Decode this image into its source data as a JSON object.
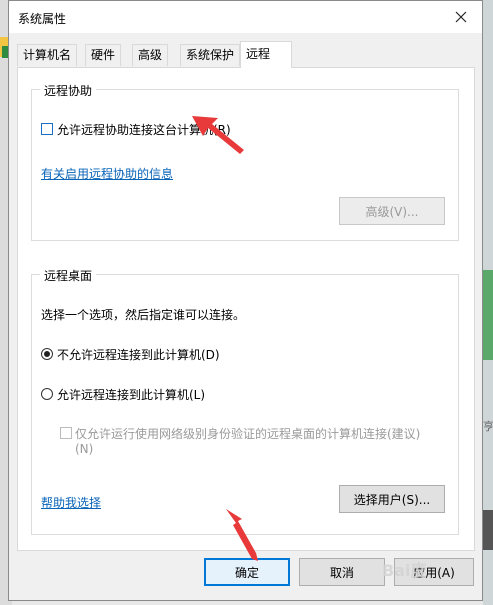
{
  "window": {
    "title": "系统属性"
  },
  "tabs": [
    {
      "label": "计算机名"
    },
    {
      "label": "硬件"
    },
    {
      "label": "高级"
    },
    {
      "label": "系统保护"
    },
    {
      "label": "远程"
    }
  ],
  "remote_assistance": {
    "group_title": "远程协助",
    "allow_label": "允许远程协助连接这台计算机(R)",
    "allow_checked": false,
    "info_link": "有关启用远程协助的信息",
    "advanced_button": "高级(V)..."
  },
  "remote_desktop": {
    "group_title": "远程桌面",
    "instruction": "选择一个选项，然后指定谁可以连接。",
    "option_deny": "不允许远程连接到此计算机(D)",
    "option_allow": "允许远程连接到此计算机(L)",
    "selected_option": "option_deny",
    "nla_label_line1": "仅允许运行使用网络级别身份验证的远程桌面的计算机连接(建议)",
    "nla_label_line2": "(N)",
    "help_link": "帮助我选择",
    "select_users_button": "选择用户(S)..."
  },
  "footer": {
    "ok_button": "确定",
    "cancel_button": "取消",
    "apply_button": "应用(A)"
  },
  "background": {
    "right_edge_text": "亨"
  },
  "colors": {
    "annotation_arrow": "#e83a3a",
    "link": "#0a64b8",
    "focus": "#0078d7"
  }
}
